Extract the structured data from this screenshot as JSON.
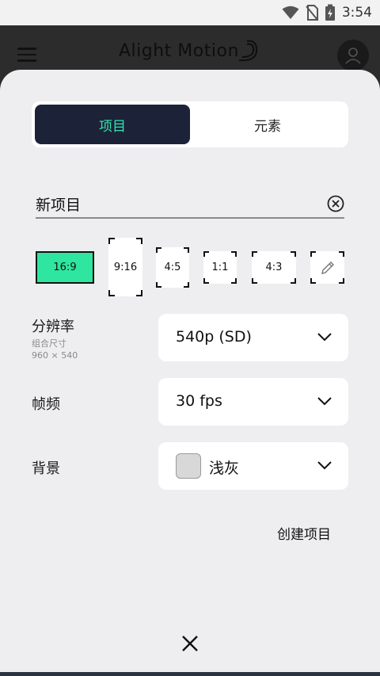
{
  "status_bar": {
    "time": "3:54"
  },
  "app_bar": {
    "logo_text": "Alight Motion"
  },
  "tabs": [
    {
      "label": "项目"
    },
    {
      "label": "元素"
    }
  ],
  "project": {
    "name": "新项目"
  },
  "aspect_ratios": [
    {
      "label": "16:9",
      "selected": true
    },
    {
      "label": "9:16"
    },
    {
      "label": "4:5"
    },
    {
      "label": "1:1"
    },
    {
      "label": "4:3"
    }
  ],
  "resolution": {
    "label": "分辨率",
    "sub1": "组合尺寸",
    "sub2": "960 × 540",
    "value": "540p (SD)"
  },
  "frame_rate": {
    "label": "帧频",
    "value": "30 fps"
  },
  "background": {
    "label": "背景",
    "value": "浅灰",
    "swatch_color": "#d8d8d8"
  },
  "actions": {
    "create": "创建项目"
  },
  "colors": {
    "accent": "#2ee6a0",
    "tab_active_bg": "#1c2238"
  }
}
